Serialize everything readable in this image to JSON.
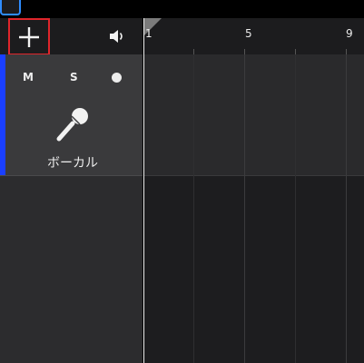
{
  "toolbar": {
    "add_track_icon": "plus-icon",
    "speaker_icon": "speaker-icon"
  },
  "ruler": {
    "labels": [
      "1",
      "5",
      "9"
    ]
  },
  "track": {
    "mute_label": "M",
    "solo_label": "S",
    "record_icon": "record-dot-icon",
    "instrument_icon": "microphone-icon",
    "name": "ボーカル",
    "color": "#1a3fff"
  },
  "colors": {
    "add_button_border": "#e0252b",
    "accent_tab": "#2f8cff"
  }
}
